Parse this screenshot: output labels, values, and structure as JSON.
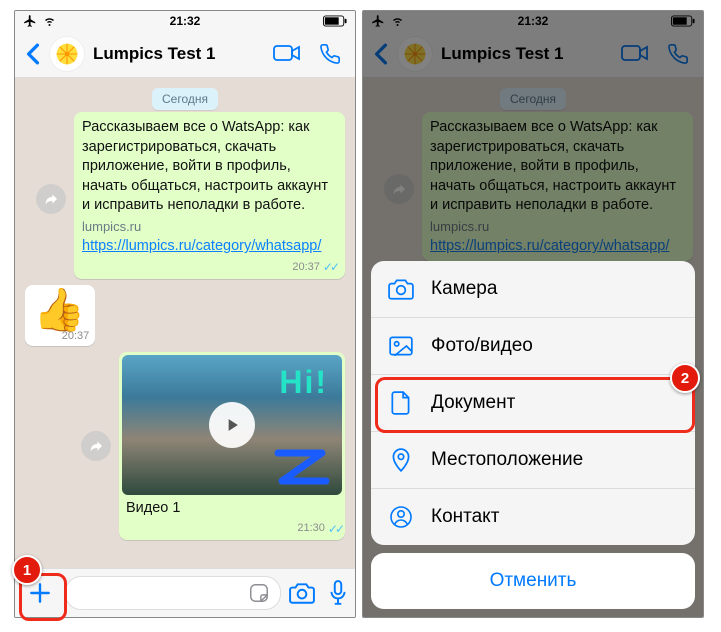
{
  "status": {
    "time": "21:32"
  },
  "chat": {
    "title": "Lumpics Test 1",
    "day_chip": "Сегодня",
    "msg1_text": "Рассказываем все о WatsApp: как зарегистрироваться, скачать приложение, войти в профиль, начать общаться, настроить аккаунт и исправить неполадки в работе.",
    "msg1_site": "lumpics.ru",
    "msg1_link": "https://lumpics.ru/category/whatsapp/",
    "msg1_time": "20:37",
    "emoji": "👍",
    "emoji_time": "20:37",
    "hi_text": "Hi!",
    "video_caption": "Видео 1",
    "video_time": "21:30"
  },
  "sheet": {
    "camera": "Камера",
    "photo": "Фото/видео",
    "document": "Документ",
    "location": "Местоположение",
    "contact": "Контакт",
    "cancel": "Отменить"
  },
  "callouts": {
    "n1": "1",
    "n2": "2"
  }
}
